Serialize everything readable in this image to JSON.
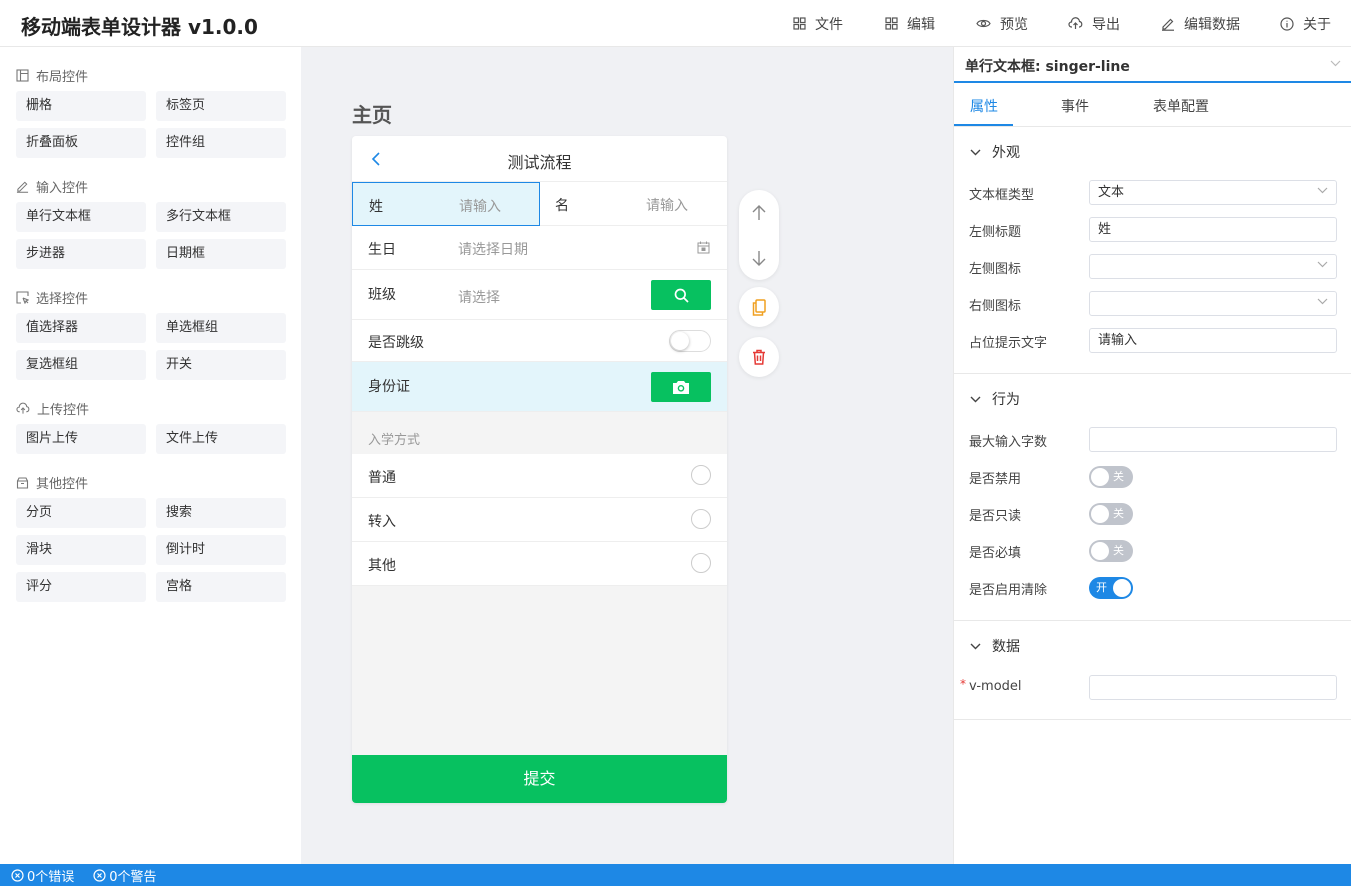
{
  "app": {
    "title": "移动端表单设计器 v1.0.0"
  },
  "topmenu": [
    {
      "label": "文件",
      "icon": "grid-icon"
    },
    {
      "label": "编辑",
      "icon": "grid-icon"
    },
    {
      "label": "预览",
      "icon": "eye-icon"
    },
    {
      "label": "导出",
      "icon": "cloud-upload-icon"
    },
    {
      "label": "编辑数据",
      "icon": "pencil-icon"
    },
    {
      "label": "关于",
      "icon": "info-icon"
    }
  ],
  "palette": {
    "groups": [
      {
        "title": "布局控件",
        "icon": "layout-icon",
        "items": [
          "栅格",
          "标签页",
          "折叠面板",
          "控件组"
        ]
      },
      {
        "title": "输入控件",
        "icon": "pencil-icon",
        "items": [
          "单行文本框",
          "多行文本框",
          "步进器",
          "日期框"
        ]
      },
      {
        "title": "选择控件",
        "icon": "cursor-select-icon",
        "items": [
          "值选择器",
          "单选框组",
          "复选框组",
          "开关"
        ]
      },
      {
        "title": "上传控件",
        "icon": "cloud-upload-icon",
        "items": [
          "图片上传",
          "文件上传"
        ]
      },
      {
        "title": "其他控件",
        "icon": "box-icon",
        "items": [
          "分页",
          "搜索",
          "滑块",
          "倒计时",
          "评分",
          "宫格"
        ]
      }
    ]
  },
  "canvas": {
    "page_title": "主页",
    "form": {
      "nav_title": "测试流程",
      "row_name": {
        "label1": "姓",
        "ph1": "请输入",
        "label2": "名",
        "ph2": "请输入"
      },
      "row_birthday": {
        "label": "生日",
        "placeholder": "请选择日期"
      },
      "row_class": {
        "label": "班级",
        "placeholder": "请选择"
      },
      "row_skip": {
        "label": "是否跳级"
      },
      "row_id": {
        "label": "身份证"
      },
      "radio_group": {
        "title": "入学方式",
        "options": [
          "普通",
          "转入",
          "其他"
        ]
      },
      "submit_label": "提交"
    }
  },
  "colors": {
    "accent": "#1e88e5",
    "primary_green": "#07c160",
    "highlight_row": "#e3f5fb",
    "status_bar": "#1e88e5"
  },
  "props": {
    "header": "单行文本框: singer-line",
    "tabs": [
      "属性",
      "事件",
      "表单配置"
    ],
    "appearance": {
      "title": "外观",
      "fields": [
        {
          "label": "文本框类型",
          "value": "文本",
          "type": "select"
        },
        {
          "label": "左侧标题",
          "value": "姓",
          "type": "input"
        },
        {
          "label": "左侧图标",
          "value": "",
          "type": "select"
        },
        {
          "label": "右侧图标",
          "value": "",
          "type": "select"
        },
        {
          "label": "占位提示文字",
          "value": "请输入",
          "type": "input"
        }
      ]
    },
    "behavior": {
      "title": "行为",
      "max_length_label": "最大输入字数",
      "max_length_value": "",
      "switches": [
        {
          "label": "是否禁用",
          "state": "关",
          "on": false
        },
        {
          "label": "是否只读",
          "state": "关",
          "on": false
        },
        {
          "label": "是否必填",
          "state": "关",
          "on": false
        },
        {
          "label": "是否启用清除",
          "state": "开",
          "on": true
        }
      ]
    },
    "data": {
      "title": "数据",
      "required_mark": "*",
      "vmodel_label": "v-model",
      "vmodel_value": ""
    }
  },
  "status": {
    "errors": "0个错误",
    "warnings": "0个警告"
  }
}
